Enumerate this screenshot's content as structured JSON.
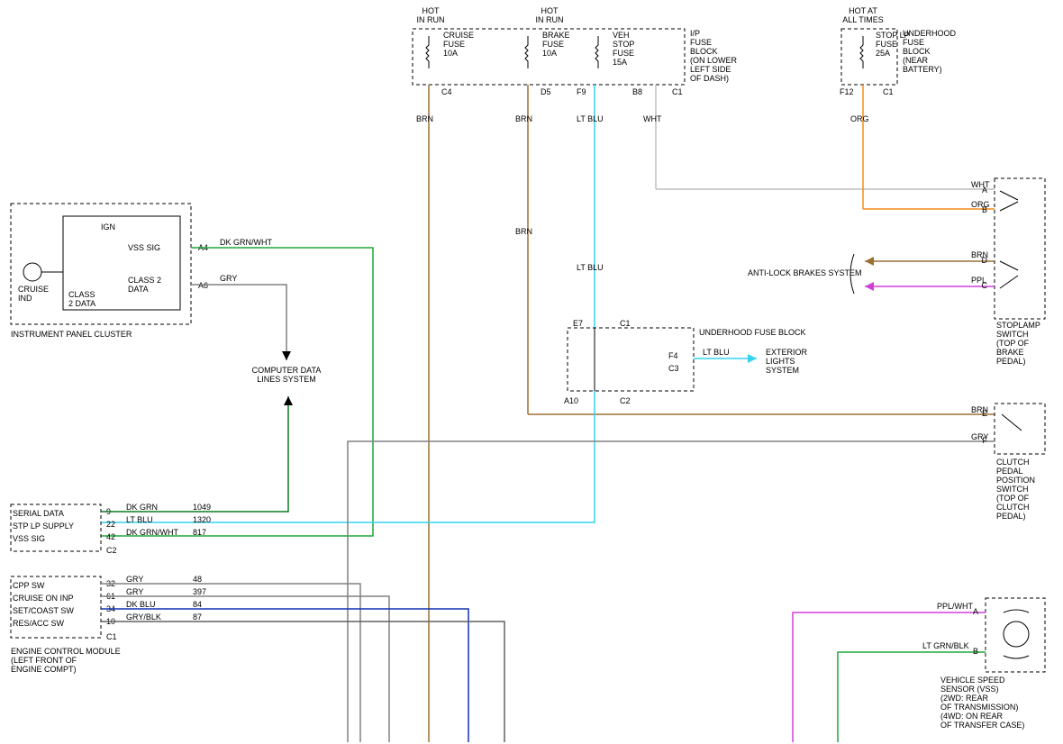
{
  "headers": {
    "hot_in_run_1": "HOT\nIN RUN",
    "hot_in_run_2": "HOT\nIN RUN",
    "hot_at_all": "HOT AT\nALL TIMES"
  },
  "fuse_block_ip": {
    "cruise": "CRUISE\nFUSE\n10A",
    "brake": "BRAKE\nFUSE\n10A",
    "veh_stop": "VEH\nSTOP\nFUSE\n15A",
    "label": "I/P\nFUSE\nBLOCK\n(ON LOWER\nLEFT SIDE\nOF DASH)"
  },
  "underhood_block_top": {
    "stop": "STOP LP\nFUSE\n25A",
    "label": "UNDERHOOD\nFUSE\nBLOCK\n(NEAR\nBATTERY)"
  },
  "underhood_block_mid": {
    "label": "UNDERHOOD FUSE BLOCK",
    "ext": "EXTERIOR\nLIGHTS\nSYSTEM"
  },
  "pins": {
    "c4": "C4",
    "d5": "D5",
    "f9": "F9",
    "b8": "B8",
    "c1": "C1",
    "f12": "F12",
    "c1b": "C1",
    "a4": "A4",
    "a6": "A6",
    "c2": "C2",
    "e7": "E7",
    "c1c": "C1",
    "f4": "F4",
    "c3": "C3",
    "a10": "A10",
    "c2b": "C2",
    "a": "A",
    "b": "B",
    "c": "C",
    "d": "D",
    "e": "E",
    "f": "F"
  },
  "colors": {
    "brn": "BRN",
    "lt_blu": "LT BLU",
    "wht": "WHT",
    "org": "ORG",
    "gry": "GRY",
    "dk_grn_wht": "DK GRN/WHT",
    "dk_grn": "DK GRN",
    "dk_blu": "DK BLU",
    "gry_blk": "GRY/BLK",
    "ppl": "PPL",
    "ppl_wht": "PPL/WHT",
    "lt_grn_blk": "LT GRN/BLK"
  },
  "instrument_panel": {
    "ign": "IGN",
    "vss_sig": "VSS SIG",
    "class2": "CLASS 2\nDATA",
    "cruise": "CRUISE\nIND",
    "class2b": "CLASS\n2 DATA",
    "label": "INSTRUMENT PANEL CLUSTER"
  },
  "computer_data": "COMPUTER DATA\nLINES SYSTEM",
  "anti_lock": "ANTI-LOCK BRAKES SYSTEM",
  "stoplamp": {
    "label": "STOPLAMP\nSWITCH\n(TOP OF\nBRAKE\nPEDAL)"
  },
  "clutch_pedal": {
    "label": "CLUTCH\nPEDAL\nPOSITION\nSWITCH\n(TOP OF\nCLUTCH\nPEDAL)"
  },
  "vss": {
    "label": "VEHICLE SPEED\nSENSOR (VSS)\n(2WD: REAR\nOF TRANSMISSION)\n(4WD: ON REAR\nOF TRANSFER CASE)"
  },
  "ecm": {
    "serial_data": "SERIAL DATA",
    "stp_lp": "STP LP SUPPLY",
    "vss_sig": "VSS SIG",
    "cpp_sw": "CPP SW",
    "cruise_on": "CRUISE ON INP",
    "set_coast": "SET/COAST SW",
    "res_acc": "RES/ACC SW",
    "label": "ENGINE CONTROL MODULE\n(LEFT FRONT OF\nENGINE COMPT)"
  },
  "ecm_pins": {
    "p9": "9",
    "p22": "22",
    "p42": "42",
    "c2": "C2",
    "p32": "32",
    "p61": "61",
    "p34": "34",
    "p10": "10",
    "c1": "C1"
  },
  "ecm_codes": {
    "c1049": "1049",
    "c1320": "1320",
    "c817": "817",
    "c48": "48",
    "c397": "397",
    "c84": "84",
    "c87": "87"
  }
}
